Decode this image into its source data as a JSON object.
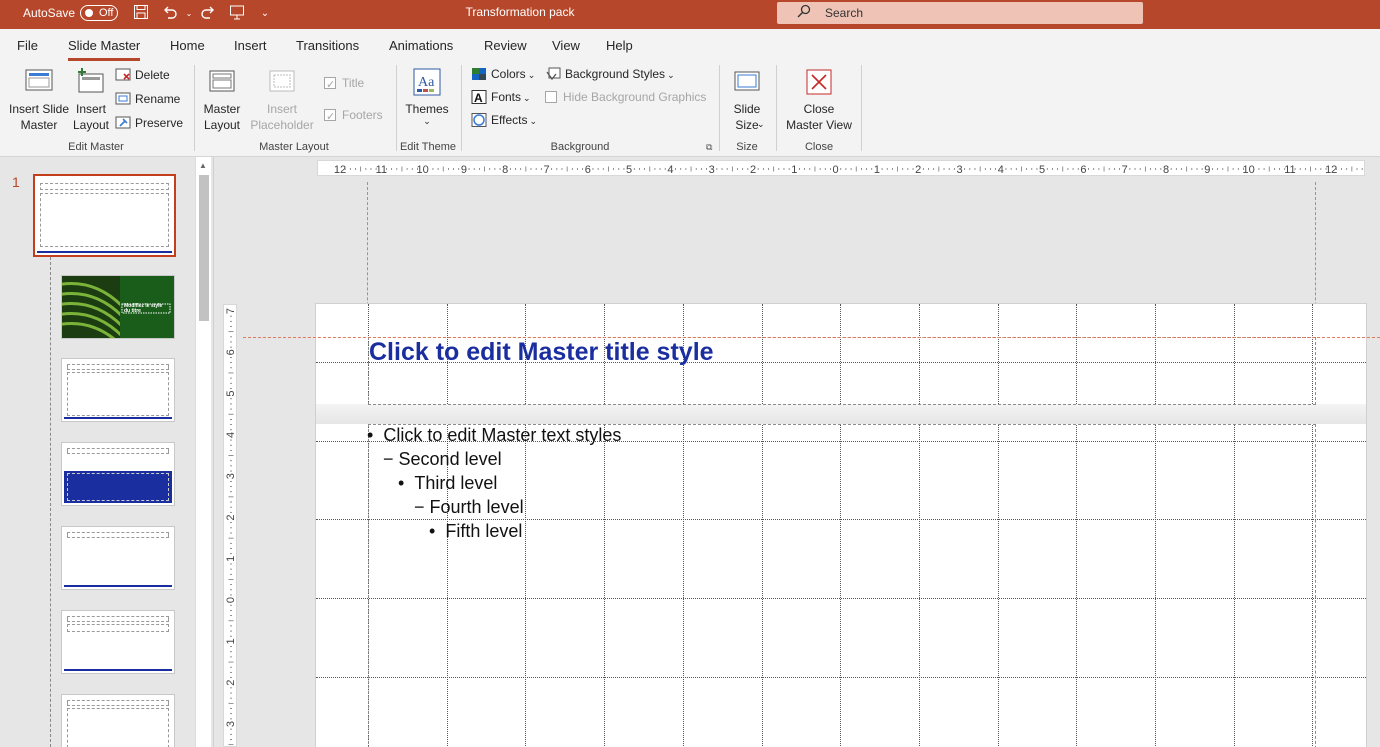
{
  "titlebar": {
    "autosave_label": "AutoSave",
    "autosave_state": "Off",
    "doc_title": "Transformation pack",
    "search_placeholder": "Search"
  },
  "tabs": [
    {
      "label": "File"
    },
    {
      "label": "Slide Master",
      "active": true
    },
    {
      "label": "Home"
    },
    {
      "label": "Insert"
    },
    {
      "label": "Transitions"
    },
    {
      "label": "Animations"
    },
    {
      "label": "Review"
    },
    {
      "label": "View"
    },
    {
      "label": "Help"
    }
  ],
  "ribbon": {
    "edit_master": {
      "label": "Edit Master",
      "insert_slide_master": "Insert Slide\nMaster",
      "insert_layout": "Insert\nLayout",
      "delete": "Delete",
      "rename": "Rename",
      "preserve": "Preserve"
    },
    "master_layout": {
      "label": "Master Layout",
      "master_layout": "Master\nLayout",
      "insert_placeholder": "Insert\nPlaceholder",
      "title": "Title",
      "footers": "Footers"
    },
    "edit_theme": {
      "label": "Edit Theme",
      "themes": "Themes"
    },
    "background": {
      "label": "Background",
      "colors": "Colors",
      "fonts": "Fonts",
      "effects": "Effects",
      "background_styles": "Background Styles",
      "hide_background_graphics": "Hide Background Graphics"
    },
    "size": {
      "label": "Size",
      "slide_size": "Slide\nSize"
    },
    "close": {
      "label": "Close",
      "close_master_view": "Close\nMaster View"
    }
  },
  "thumbnails": {
    "selected_number": "1",
    "thumb2_title": "Modifiez le style du titre"
  },
  "slide": {
    "title": "Click to edit Master title style",
    "levels": [
      "Click to edit Master text styles",
      "Second level",
      "Third level",
      "Fourth level",
      "Fifth level"
    ],
    "bullets": [
      "•",
      "−",
      "•",
      "−",
      "•"
    ]
  },
  "rulers": {
    "horizontal": [
      "12",
      "11",
      "10",
      "9",
      "8",
      "7",
      "6",
      "5",
      "4",
      "3",
      "2",
      "1",
      "0",
      "1",
      "2",
      "3",
      "4",
      "5",
      "6",
      "7",
      "8",
      "9",
      "10",
      "11",
      "12"
    ],
    "vertical": [
      "7",
      "6",
      "5",
      "4",
      "3",
      "2",
      "1",
      "0",
      "1",
      "2",
      "3"
    ]
  },
  "colors": {
    "accent": "#b7472a",
    "title_blue": "#1a2ea0"
  }
}
